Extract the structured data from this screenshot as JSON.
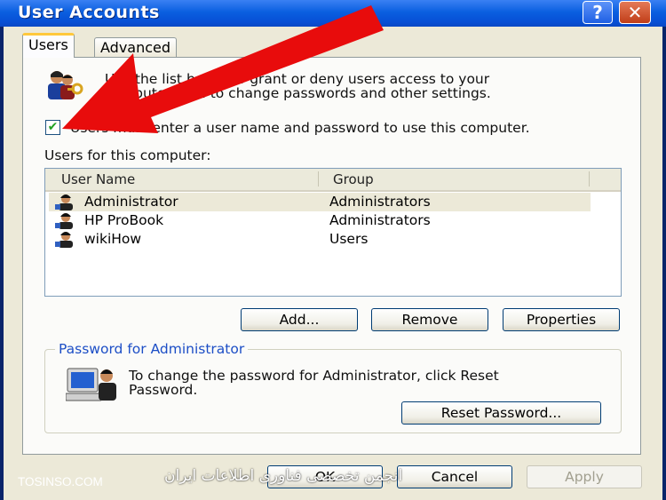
{
  "window": {
    "title": "User Accounts",
    "help_label": "?",
    "close_label": "✕"
  },
  "tabs": [
    {
      "label": "Users",
      "active": true
    },
    {
      "label": "Advanced",
      "active": false
    }
  ],
  "intro": {
    "line1": "Use the list below to grant or deny users access to your",
    "line2": "computer, and to change passwords and other settings."
  },
  "require_login": {
    "checked": true,
    "label": "Users must enter a user name and password to use this computer."
  },
  "users_section_label": "Users for this computer:",
  "users_table": {
    "columns": [
      "User Name",
      "Group"
    ],
    "rows": [
      {
        "name": "Administrator",
        "group": "Administrators",
        "selected": true
      },
      {
        "name": "HP ProBook",
        "group": "Administrators",
        "selected": false
      },
      {
        "name": "wikiHow",
        "group": "Users",
        "selected": false
      }
    ]
  },
  "buttons": {
    "add": "Add...",
    "remove": "Remove",
    "properties": "Properties",
    "reset_password": "Reset Password...",
    "ok": "OK",
    "cancel": "Cancel",
    "apply": "Apply"
  },
  "password_group": {
    "title": "Password for Administrator",
    "line1": "To change the password for Administrator, click Reset",
    "line2": "Password."
  },
  "watermark": {
    "left": "TOSINSO.COM",
    "right": "انجمن تخصصی فناوری اطلاعات ایران"
  },
  "colors": {
    "titlebar": "#0a5fe0",
    "arrow": "#e80c0c",
    "group_title": "#1c4ec6",
    "checkmark": "#21a121"
  }
}
